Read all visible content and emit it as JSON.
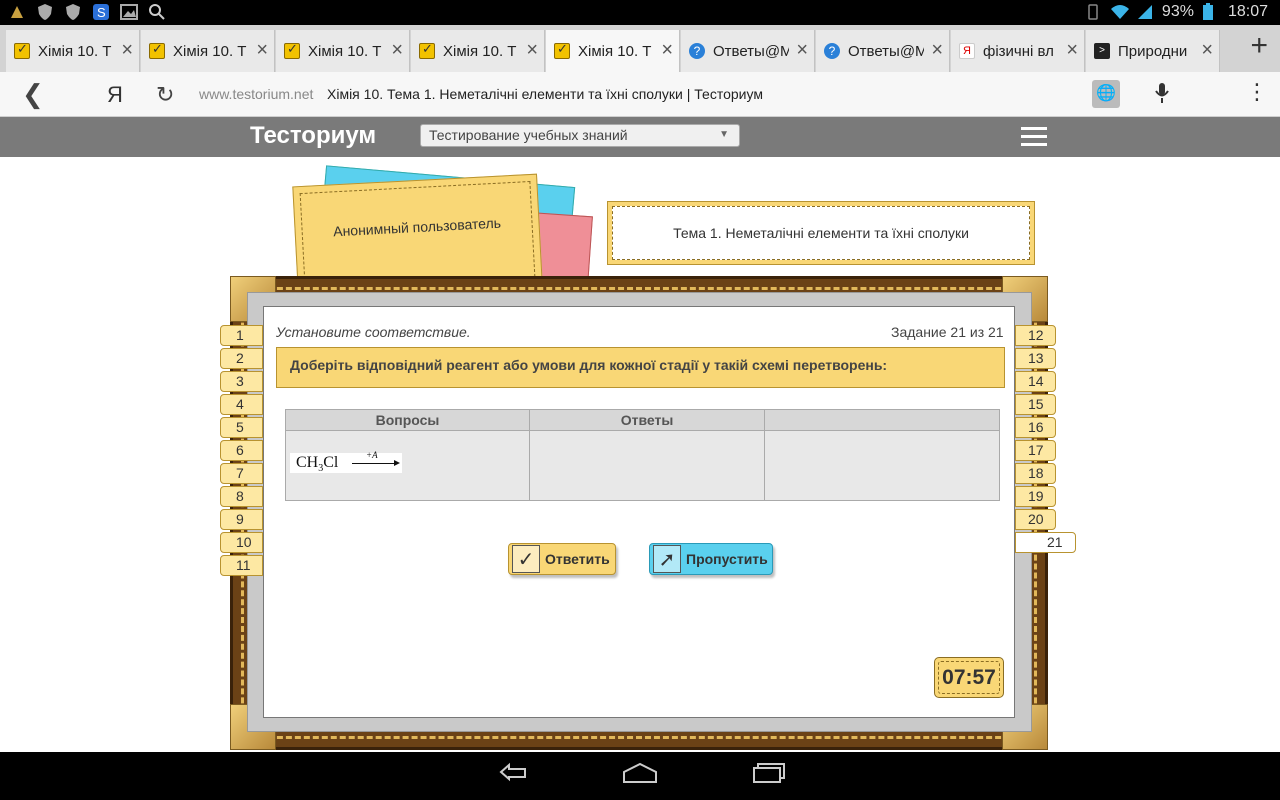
{
  "status_bar": {
    "battery": "93%",
    "time": "18:07"
  },
  "tabs": [
    {
      "label": "Хімія 10. Т",
      "favicon": "check-icon",
      "active": false
    },
    {
      "label": "Хімія 10. Т",
      "favicon": "check-icon",
      "active": false
    },
    {
      "label": "Хімія 10. Т",
      "favicon": "check-icon",
      "active": false
    },
    {
      "label": "Хімія 10. Т",
      "favicon": "check-icon",
      "active": false
    },
    {
      "label": "Хімія 10. Т",
      "favicon": "check-icon",
      "active": true
    },
    {
      "label": "Ответы@М",
      "favicon": "question-icon",
      "active": false
    },
    {
      "label": "Ответы@М",
      "favicon": "question-icon",
      "active": false
    },
    {
      "label": "фізичні вл",
      "favicon": "yandex-icon",
      "active": false
    },
    {
      "label": "Природни",
      "favicon": "terminal-icon",
      "active": false
    }
  ],
  "omnibox": {
    "yandex": "Я",
    "domain": "www.testorium.net",
    "title": "Хімія 10. Тема 1. Неметалічні елементи та їхні сполуки | Тесториум"
  },
  "site": {
    "logo": "Тесториум",
    "select_value": "Тестирование учебных знаний"
  },
  "user_label": "Анонимный пользователь",
  "topic": "Тема 1. Неметалічні елементи та їхні сполуки",
  "instruction": "Установите соответствие.",
  "counter": "Задание 21 из 21",
  "question": "Доберіть відповідний реагент або умови для кожної стадії у такій схемі перетворень:",
  "table": {
    "headers": [
      "Вопросы",
      "Ответы",
      ""
    ],
    "formula_main": "CH",
    "formula_sub": "3",
    "formula_tail": "Cl",
    "arrow_label": "+A"
  },
  "buttons": {
    "answer": "Ответить",
    "skip": "Пропустить"
  },
  "timer": "07:57",
  "question_numbers_left": [
    "1",
    "2",
    "3",
    "4",
    "5",
    "6",
    "7",
    "8",
    "9",
    "10",
    "11"
  ],
  "question_numbers_right": [
    "12",
    "13",
    "14",
    "15",
    "16",
    "17",
    "18",
    "19",
    "20"
  ],
  "current_question": "21",
  "colors": {
    "accent_yellow": "#f9d776",
    "accent_blue": "#5ad0ee",
    "accent_red": "#ef8f97",
    "frame_brown": "#6b4216"
  }
}
